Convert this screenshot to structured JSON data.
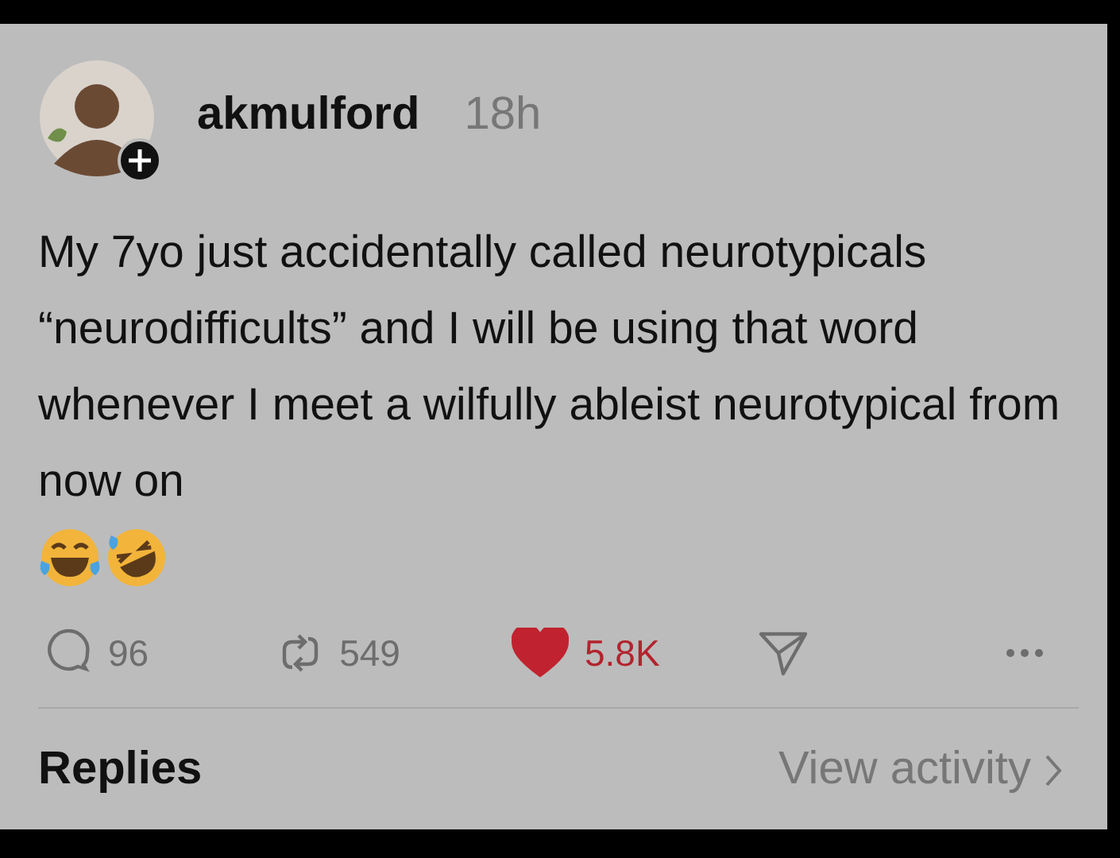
{
  "post": {
    "username": "akmulford",
    "time": "18h",
    "text": "My 7yo just accidentally called neurotypicals “neurodifficults” and I will be using that word whenever I meet a wilfully ableist neurotypical from now on"
  },
  "actions": {
    "replies": "96",
    "reposts": "549",
    "likes": "5.8K",
    "liked": true
  },
  "footer": {
    "replies_label": "Replies",
    "activity_link": "View activity"
  }
}
